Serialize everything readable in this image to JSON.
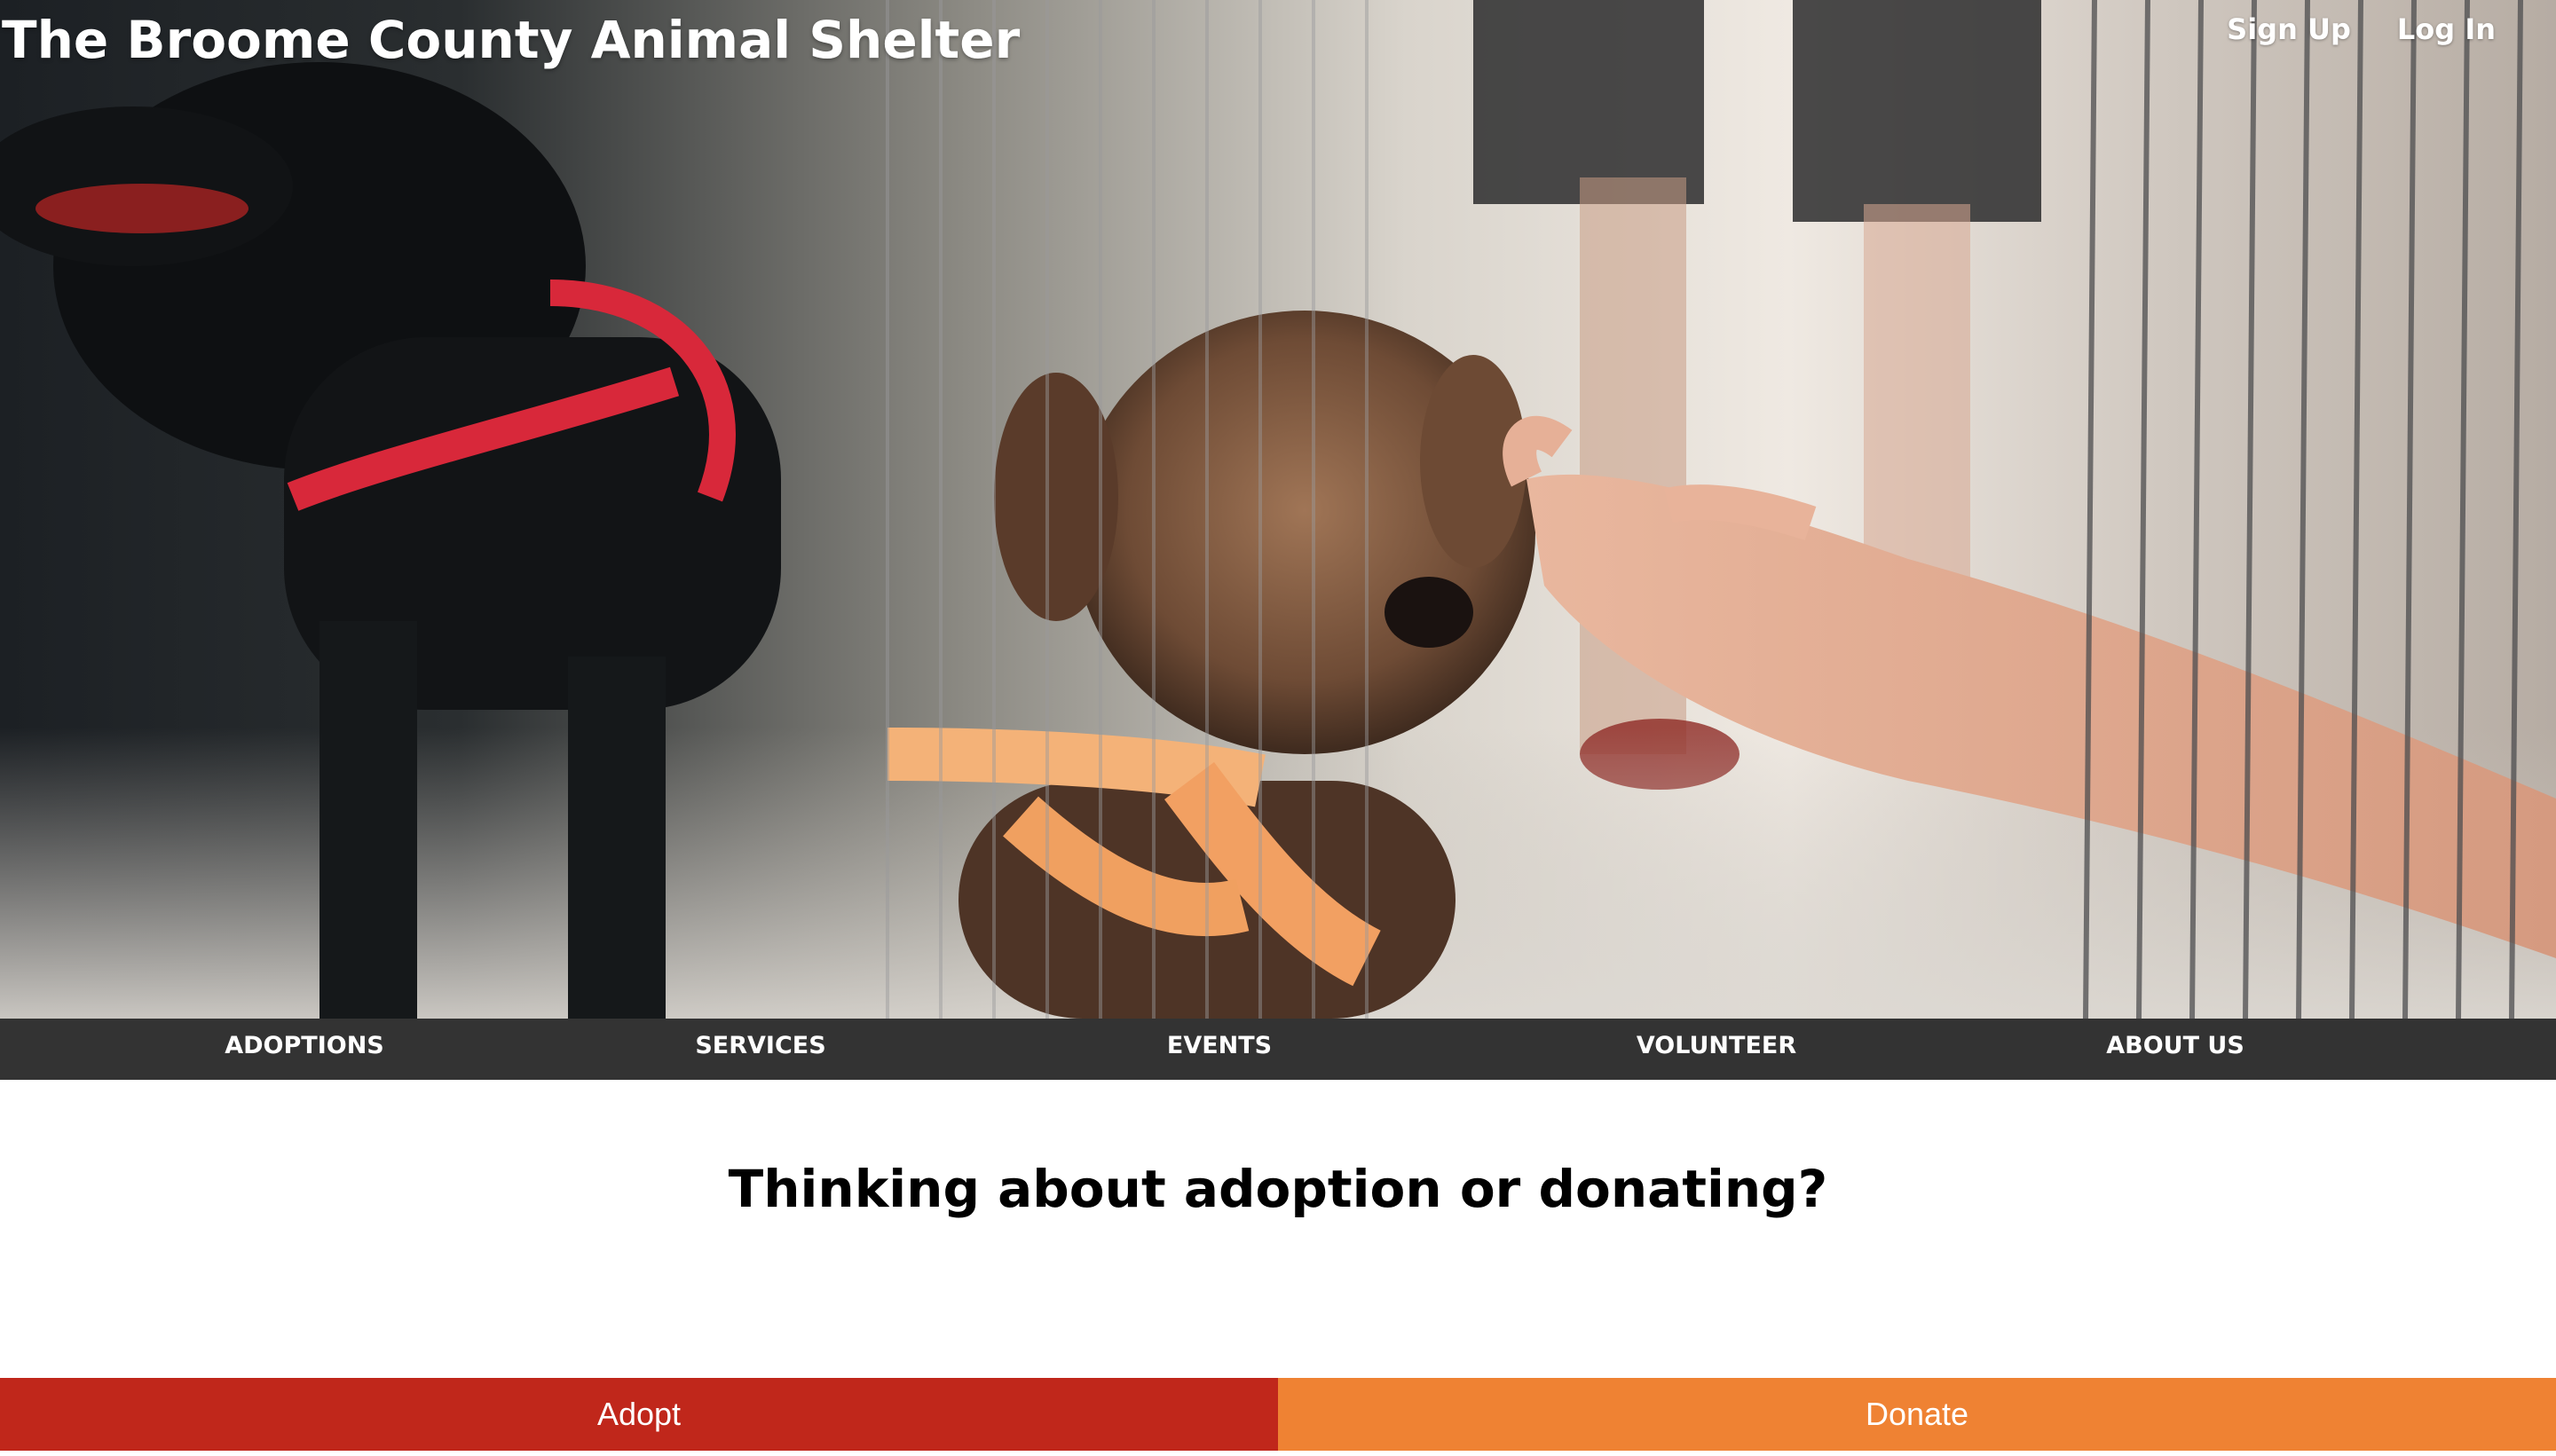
{
  "header": {
    "title": "The Broome County Animal Shelter",
    "auth_links": [
      "Sign Up",
      "Log In"
    ]
  },
  "hero": {
    "image": "shelter-puppies-photo"
  },
  "nav": {
    "items": [
      "ADOPTIONS",
      "SERVICES",
      "EVENTS",
      "VOLUNTEER",
      "ABOUT US"
    ]
  },
  "main": {
    "headline": "Thinking about adoption or donating?"
  },
  "cta": {
    "adopt_label": "Adopt",
    "donate_label": "Donate",
    "colors": {
      "adopt": "#c0271b",
      "donate": "#ef8233",
      "nav_bg": "#333333"
    }
  }
}
